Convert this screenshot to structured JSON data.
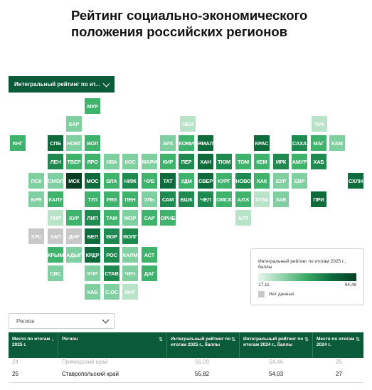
{
  "title_line1": "Рейтинг социально-экономического",
  "title_line2": "положения российских регионов",
  "rating_dropdown": "Интегральный рейтинг по ит...",
  "colors": {
    "darkest": "#063f23",
    "dark": "#0d6b3c",
    "mid": "#1f8a4f",
    "light": "#3fb26c",
    "lighter": "#80cfa0",
    "pale": "#b8e3c9",
    "nodata": "#c8c8c8",
    "header": "#0b5a3a"
  },
  "tiles": [
    {
      "label": "МУР",
      "lvl": 3
    },
    {
      "label": "КАР",
      "lvl": 4
    },
    {
      "label": "НЕН",
      "lvl": 5
    },
    {
      "label": "ЧУК",
      "lvl": 5
    },
    {
      "label": "КНГ",
      "lvl": 3
    },
    {
      "label": "СПБ",
      "lvl": 1
    },
    {
      "label": "НОВГ",
      "lvl": 4
    },
    {
      "label": "ВОЛ",
      "lvl": 3
    },
    {
      "label": "АРХ",
      "lvl": 4
    },
    {
      "label": "КОМИ",
      "lvl": 3
    },
    {
      "label": "ЯМАЛ",
      "lvl": 1
    },
    {
      "label": "КРАС",
      "lvl": 1
    },
    {
      "label": "САХА",
      "lvl": 2
    },
    {
      "label": "МАГ",
      "lvl": 3
    },
    {
      "label": "КАМ",
      "lvl": 4
    },
    {
      "label": "ЛЕН",
      "lvl": 2
    },
    {
      "label": "ТВЕР",
      "lvl": 3
    },
    {
      "label": "ЯРО",
      "lvl": 3
    },
    {
      "label": "ИВА",
      "lvl": 4
    },
    {
      "label": "КОС",
      "lvl": 4
    },
    {
      "label": "МАРИ",
      "lvl": 4
    },
    {
      "label": "КИР",
      "lvl": 3
    },
    {
      "label": "ПЕР",
      "lvl": 2
    },
    {
      "label": "ХАН",
      "lvl": 1
    },
    {
      "label": "ТЮМ",
      "lvl": 2
    },
    {
      "label": "ТОМ",
      "lvl": 3
    },
    {
      "label": "КЕМ",
      "lvl": 3
    },
    {
      "label": "ИРК",
      "lvl": 2
    },
    {
      "label": "АМУР",
      "lvl": 3
    },
    {
      "label": "ХАБ",
      "lvl": 2
    },
    {
      "label": "ПСК",
      "lvl": 4
    },
    {
      "label": "СМОЛ",
      "lvl": 4
    },
    {
      "label": "МСК",
      "lvl": 0
    },
    {
      "label": "МОС",
      "lvl": 1
    },
    {
      "label": "ВЛА",
      "lvl": 3
    },
    {
      "label": "НИЖ",
      "lvl": 2
    },
    {
      "label": "ЧУВ",
      "lvl": 3
    },
    {
      "label": "ТАТ",
      "lvl": 1
    },
    {
      "label": "УДМ",
      "lvl": 3
    },
    {
      "label": "СВЕР",
      "lvl": 1
    },
    {
      "label": "КУРГ",
      "lvl": 3
    },
    {
      "label": "НОВО",
      "lvl": 2
    },
    {
      "label": "ХАК",
      "lvl": 3
    },
    {
      "label": "БУР",
      "lvl": 4
    },
    {
      "label": "ЕВР",
      "lvl": 4
    },
    {
      "label": "СХЛН",
      "lvl": 1
    },
    {
      "label": "БРЯ",
      "lvl": 4
    },
    {
      "label": "КАЛУ",
      "lvl": 3
    },
    {
      "label": "ТУЛ",
      "lvl": 3
    },
    {
      "label": "РЯЗ",
      "lvl": 3
    },
    {
      "label": "ПЕН",
      "lvl": 3
    },
    {
      "label": "УЛЬ",
      "lvl": 4
    },
    {
      "label": "САМ",
      "lvl": 2
    },
    {
      "label": "БШК",
      "lvl": 2
    },
    {
      "label": "ЧЕЛ",
      "lvl": 2
    },
    {
      "label": "ОМСК",
      "lvl": 3
    },
    {
      "label": "АЛ.К",
      "lvl": 3
    },
    {
      "label": "ТУВА",
      "lvl": 5
    },
    {
      "label": "ЗАБ",
      "lvl": 4
    },
    {
      "label": "ПРИ",
      "lvl": 1
    },
    {
      "label": "ЛНР",
      "lvl": 5
    },
    {
      "label": "КУР",
      "lvl": 3
    },
    {
      "label": "ЛИП",
      "lvl": 2
    },
    {
      "label": "ТАМ",
      "lvl": 3
    },
    {
      "label": "МОР",
      "lvl": 4
    },
    {
      "label": "САР",
      "lvl": 3
    },
    {
      "label": "ОРНБ",
      "lvl": 3
    },
    {
      "label": "АЛТ",
      "lvl": 5
    },
    {
      "label": "ХРС",
      "lvl": 6
    },
    {
      "label": "ЗАП",
      "lvl": 6
    },
    {
      "label": "ДНР",
      "lvl": 6
    },
    {
      "label": "БЕЛ",
      "lvl": 1
    },
    {
      "label": "ВОР",
      "lvl": 2
    },
    {
      "label": "ВОЛГ",
      "lvl": 2
    },
    {
      "label": "КРЫМ",
      "lvl": 3
    },
    {
      "label": "АДЫГ",
      "lvl": 4
    },
    {
      "label": "КРДР",
      "lvl": 1
    },
    {
      "label": "РОС",
      "lvl": 2
    },
    {
      "label": "КАЛМ",
      "lvl": 4
    },
    {
      "label": "АСТ",
      "lvl": 3
    },
    {
      "label": "СВС",
      "lvl": 4
    },
    {
      "label": "КЧР",
      "lvl": 4
    },
    {
      "label": "СТАВ",
      "lvl": 2
    },
    {
      "label": "ЧЕЧ",
      "lvl": 4
    },
    {
      "label": "ДАГ",
      "lvl": 3
    },
    {
      "label": "КАБ",
      "lvl": 4
    },
    {
      "label": "С.ОС",
      "lvl": 4
    },
    {
      "label": "ИНГ",
      "lvl": 5
    }
  ],
  "legend": {
    "title": "Интегральный рейтинг по итогам 2025 г., баллы",
    "min": "17,11",
    "max": "94,48",
    "nodata": "Нет данных"
  },
  "region_dropdown": "Регион",
  "table": {
    "headers": [
      "Место по итогам 2025 г.",
      "Регион",
      "Интегральный рейтинг по итогам 2025 г., баллы",
      "Интегральный рейтинг по итогам 2024 г., баллы",
      "Место по итогам 2024 г."
    ],
    "ghost_row": [
      "24",
      "Приморский край",
      "56,09",
      "54,46",
      "25"
    ],
    "row": [
      "25",
      "Ставропольский край",
      "55,82",
      "54,03",
      "27"
    ]
  }
}
